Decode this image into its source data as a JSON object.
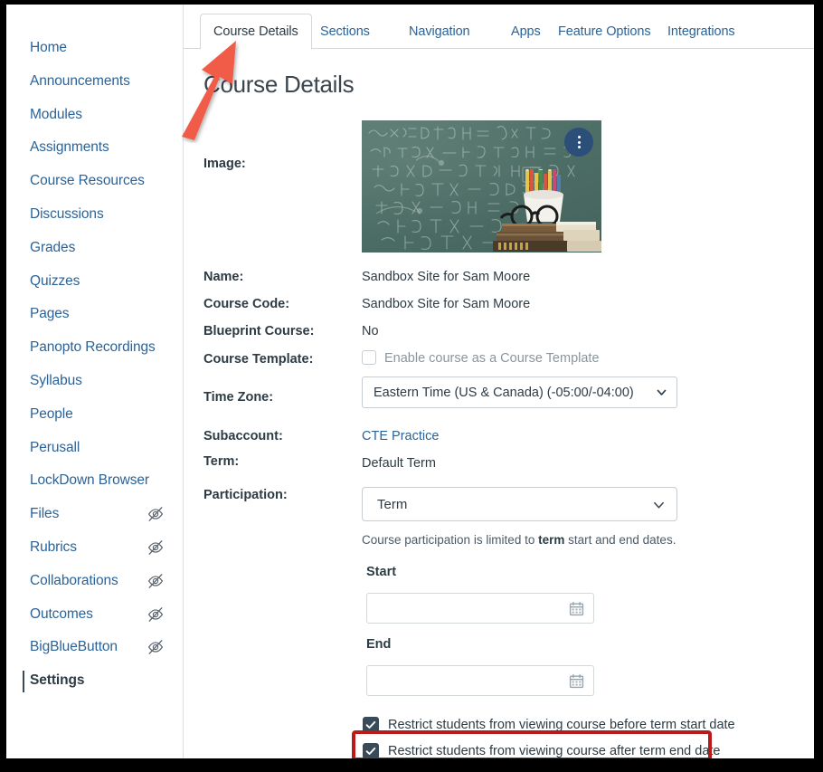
{
  "sidebar": {
    "items": [
      {
        "label": "Home",
        "hidden_icon": false,
        "active": false
      },
      {
        "label": "Announcements",
        "hidden_icon": false,
        "active": false
      },
      {
        "label": "Modules",
        "hidden_icon": false,
        "active": false
      },
      {
        "label": "Assignments",
        "hidden_icon": false,
        "active": false
      },
      {
        "label": "Course Resources",
        "hidden_icon": false,
        "active": false
      },
      {
        "label": "Discussions",
        "hidden_icon": false,
        "active": false
      },
      {
        "label": "Grades",
        "hidden_icon": false,
        "active": false
      },
      {
        "label": "Quizzes",
        "hidden_icon": false,
        "active": false
      },
      {
        "label": "Pages",
        "hidden_icon": false,
        "active": false
      },
      {
        "label": "Panopto Recordings",
        "hidden_icon": false,
        "active": false
      },
      {
        "label": "Syllabus",
        "hidden_icon": false,
        "active": false
      },
      {
        "label": "People",
        "hidden_icon": false,
        "active": false
      },
      {
        "label": "Perusall",
        "hidden_icon": false,
        "active": false
      },
      {
        "label": "LockDown Browser",
        "hidden_icon": false,
        "active": false
      },
      {
        "label": "Files",
        "hidden_icon": true,
        "active": false
      },
      {
        "label": "Rubrics",
        "hidden_icon": true,
        "active": false
      },
      {
        "label": "Collaborations",
        "hidden_icon": true,
        "active": false
      },
      {
        "label": "Outcomes",
        "hidden_icon": true,
        "active": false
      },
      {
        "label": "BigBlueButton",
        "hidden_icon": true,
        "active": false
      },
      {
        "label": "Settings",
        "hidden_icon": false,
        "active": true
      }
    ]
  },
  "tabs": [
    {
      "label": "Course Details",
      "active": true
    },
    {
      "label": "Sections",
      "active": false
    },
    {
      "label": "Navigation",
      "active": false
    },
    {
      "label": "Apps",
      "active": false
    },
    {
      "label": "Feature Options",
      "active": false
    },
    {
      "label": "Integrations",
      "active": false
    }
  ],
  "page": {
    "title": "Course Details"
  },
  "form": {
    "image_label": "Image:",
    "name_label": "Name:",
    "name_value": "Sandbox Site for Sam Moore",
    "course_code_label": "Course Code:",
    "course_code_value": "Sandbox Site for Sam Moore",
    "blueprint_label": "Blueprint Course:",
    "blueprint_value": "No",
    "course_template_label": "Course Template:",
    "course_template_checkbox_label": "Enable course as a Course Template",
    "timezone_label": "Time Zone:",
    "timezone_value": "Eastern Time (US & Canada) (-05:00/-04:00)",
    "subaccount_label": "Subaccount:",
    "subaccount_value": "CTE Practice",
    "term_label": "Term:",
    "term_value": "Default Term",
    "participation_label": "Participation:",
    "participation_value": "Term",
    "participation_help_prefix": "Course participation is limited to ",
    "participation_help_bold": "term",
    "participation_help_suffix": " start and end dates.",
    "start_label": "Start",
    "start_value": "",
    "end_label": "End",
    "end_value": "",
    "restrict_before_label": "Restrict students from viewing course before term start date",
    "restrict_after_label": "Restrict students from viewing course after term end date"
  },
  "annotations": {
    "arrow_color": "#f15b4a",
    "highlight_color": "#bb1a1a",
    "highlight_target": "restrict-after-term-end-date"
  },
  "colors": {
    "link": "#2a6399",
    "text": "#2d3b45",
    "accent_dark_blue": "#2b4f79",
    "border": "#c7cdd1"
  }
}
